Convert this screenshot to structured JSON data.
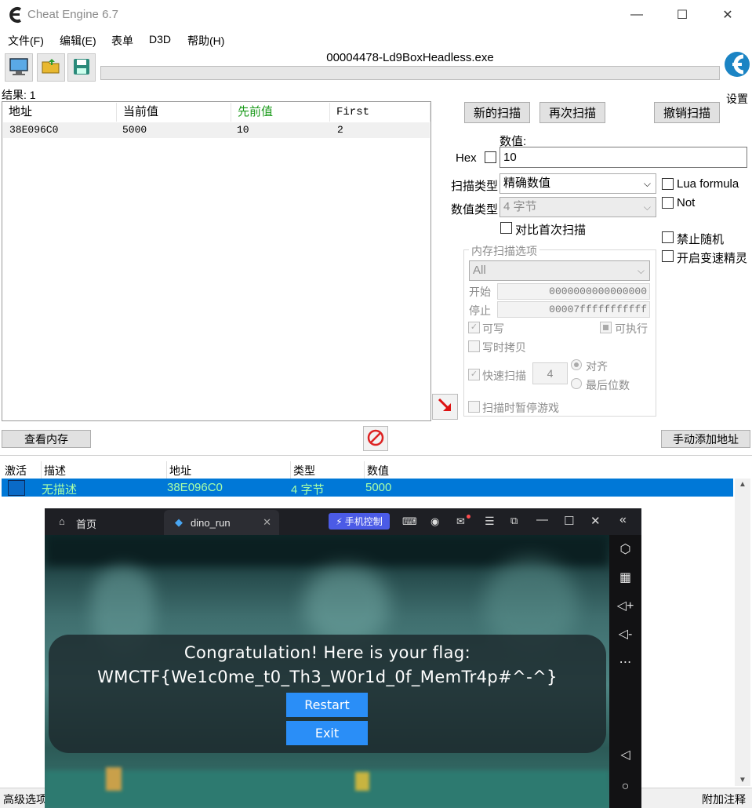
{
  "window": {
    "title": "Cheat Engine 6.7",
    "min": "—",
    "max": "☐",
    "close": "✕"
  },
  "menu": [
    "文件(F)",
    "编辑(E)",
    "表单",
    "D3D",
    "帮助(H)"
  ],
  "toolbar": {
    "process": "00004478-Ld9BoxHeadless.exe",
    "settings_label": "设置"
  },
  "results": {
    "count": "结果: 1",
    "columns": [
      "地址",
      "当前值",
      "先前值",
      "First"
    ],
    "rows": [
      [
        "38E096C0",
        "5000",
        "10",
        "2"
      ]
    ]
  },
  "scan": {
    "new_scan": "新的扫描",
    "next_scan": "再次扫描",
    "undo_scan": "撤销扫描",
    "value_label": "数值:",
    "hex_label": "Hex",
    "value": "10",
    "scan_type_label": "扫描类型",
    "scan_type": "精确数值",
    "value_type_label": "数值类型",
    "value_type": "4 字节",
    "compare_first": "对比首次扫描",
    "lua_formula": "Lua formula",
    "not": "Not",
    "disable_random": "禁止随机",
    "speedhack": "开启变速精灵",
    "mem_options_title": "内存扫描选项",
    "region": "All",
    "start_label": "开始",
    "start_value": "0000000000000000",
    "stop_label": "停止",
    "stop_value": "00007fffffffffff",
    "writable": "可写",
    "executable": "可执行",
    "copy_on_write": "写时拷贝",
    "fast_scan": "快速扫描",
    "fast_scan_value": "4",
    "align": "对齐",
    "last_digits": "最后位数",
    "pause_game": "扫描时暂停游戏"
  },
  "memory_view_button": "查看内存",
  "add_address_button": "手动添加地址",
  "address_list": {
    "columns": [
      "激活",
      "描述",
      "地址",
      "类型",
      "数值"
    ],
    "rows": [
      [
        "",
        "无描述",
        "38E096C0",
        "4 字节",
        "5000"
      ]
    ]
  },
  "emulator": {
    "home_tab": "首页",
    "app_tab": "dino_run",
    "phone_control": "手机控制",
    "dialog_line1": "Congratulation! Here is your flag:",
    "dialog_line2": "WMCTF{We1c0me_t0_Th3_W0r1d_0f_MemTr4p#^-^}",
    "restart": "Restart",
    "exit": "Exit"
  },
  "footer": {
    "advanced": "高级选项",
    "notes": "附加注释"
  },
  "colors": {
    "selection": "#0078d7",
    "row_text": "#a8ffa8",
    "previous_header": "#1a9a1a",
    "game_button": "#2a8ef7"
  }
}
